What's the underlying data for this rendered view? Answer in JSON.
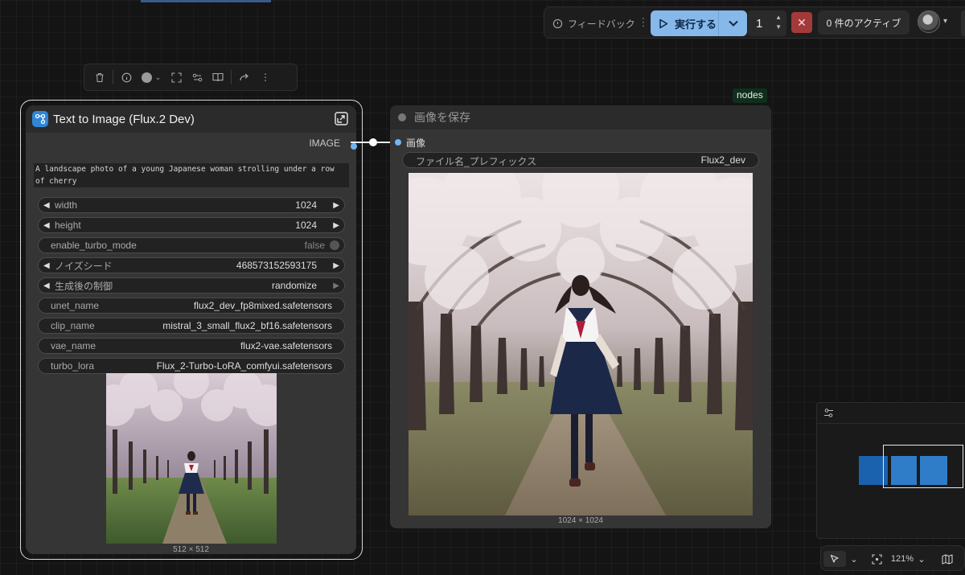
{
  "topbar": {
    "feedback_label": "フィードバック",
    "run_label": "実行する",
    "batch_count": "1",
    "active_label": "0 件のアクティブ"
  },
  "toolbox": {
    "tools": [
      "trash-icon",
      "info-icon",
      "color-picker",
      "fit-icon",
      "settings-icon",
      "book-icon",
      "redo-icon",
      "more-icon"
    ]
  },
  "node1": {
    "title": "Text to Image (Flux.2 Dev)",
    "output_label": "IMAGE",
    "prompt": "A landscape photo of a young Japanese woman strolling under a row of cherry\nblossom trees, gazing up at the blossoms in full bloom. She is wearing a",
    "widgets": {
      "width": {
        "label": "width",
        "value": "1024"
      },
      "height": {
        "label": "height",
        "value": "1024"
      },
      "turbo": {
        "label": "enable_turbo_mode",
        "value": "false"
      },
      "seed": {
        "label": "ノイズシード",
        "value": "468573152593175"
      },
      "control": {
        "label": "生成後の制御",
        "value": "randomize"
      },
      "unet": {
        "label": "unet_name",
        "value": "flux2_dev_fp8mixed.safetensors"
      },
      "clip": {
        "label": "clip_name",
        "value": "mistral_3_small_flux2_bf16.safetensors"
      },
      "vae": {
        "label": "vae_name",
        "value": "flux2-vae.safetensors"
      },
      "lora": {
        "label": "turbo_lora",
        "value": "Flux_2-Turbo-LoRA_comfyui.safetensors"
      }
    },
    "image_caption": "512 × 512"
  },
  "node2": {
    "badge": "nodes",
    "title": "画像を保存",
    "input_label": "画像",
    "prefix_label": "ファイル名_プレフィックス",
    "prefix_value": "Flux2_dev",
    "image_caption": "1024 × 1024"
  },
  "controls": {
    "zoom": "121%"
  },
  "colors": {
    "accent": "#86b8ea",
    "slot": "#6eb6f5",
    "cancel": "#a33a3a",
    "subgraph_icon": "#2f86d6"
  }
}
